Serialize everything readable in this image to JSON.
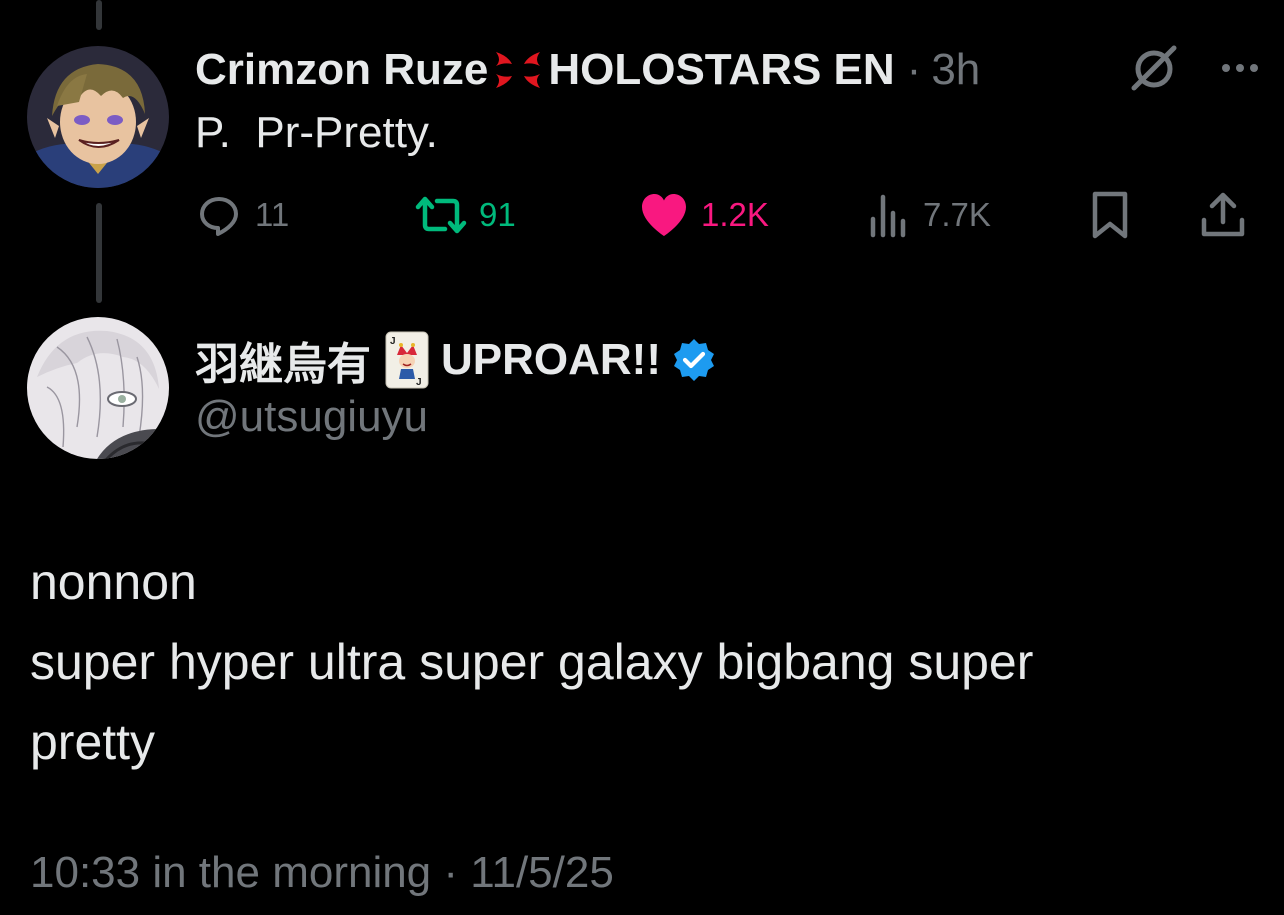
{
  "reply_tweet": {
    "display_name": "Crimzon Ruze",
    "affiliation": "HOLOSTARS EN",
    "separator": "·",
    "time_ago": "3h",
    "text": "P.  Pr-Pretty.",
    "icons": {
      "emoji": "anger-symbol-emoji",
      "grok": "grok-icon",
      "more": "more-icon"
    },
    "actions": {
      "reply_count": "11",
      "retweet_count": "91",
      "like_count": "1.2K",
      "view_count": "7.7K"
    },
    "colors": {
      "retweet": "#00ba7c",
      "like": "#f91880",
      "muted": "#71767b"
    }
  },
  "main_tweet": {
    "display_name": "羽継烏有",
    "name_suffix": "UPROAR!!",
    "handle": "@utsugiuyu",
    "verified_color": "#1d9bf0",
    "body_lines": [
      "nonnon",
      "super hyper ultra super galaxy bigbang super",
      "pretty"
    ],
    "time": "10:33 in the morning",
    "separator": "·",
    "date": "11/5/25"
  }
}
